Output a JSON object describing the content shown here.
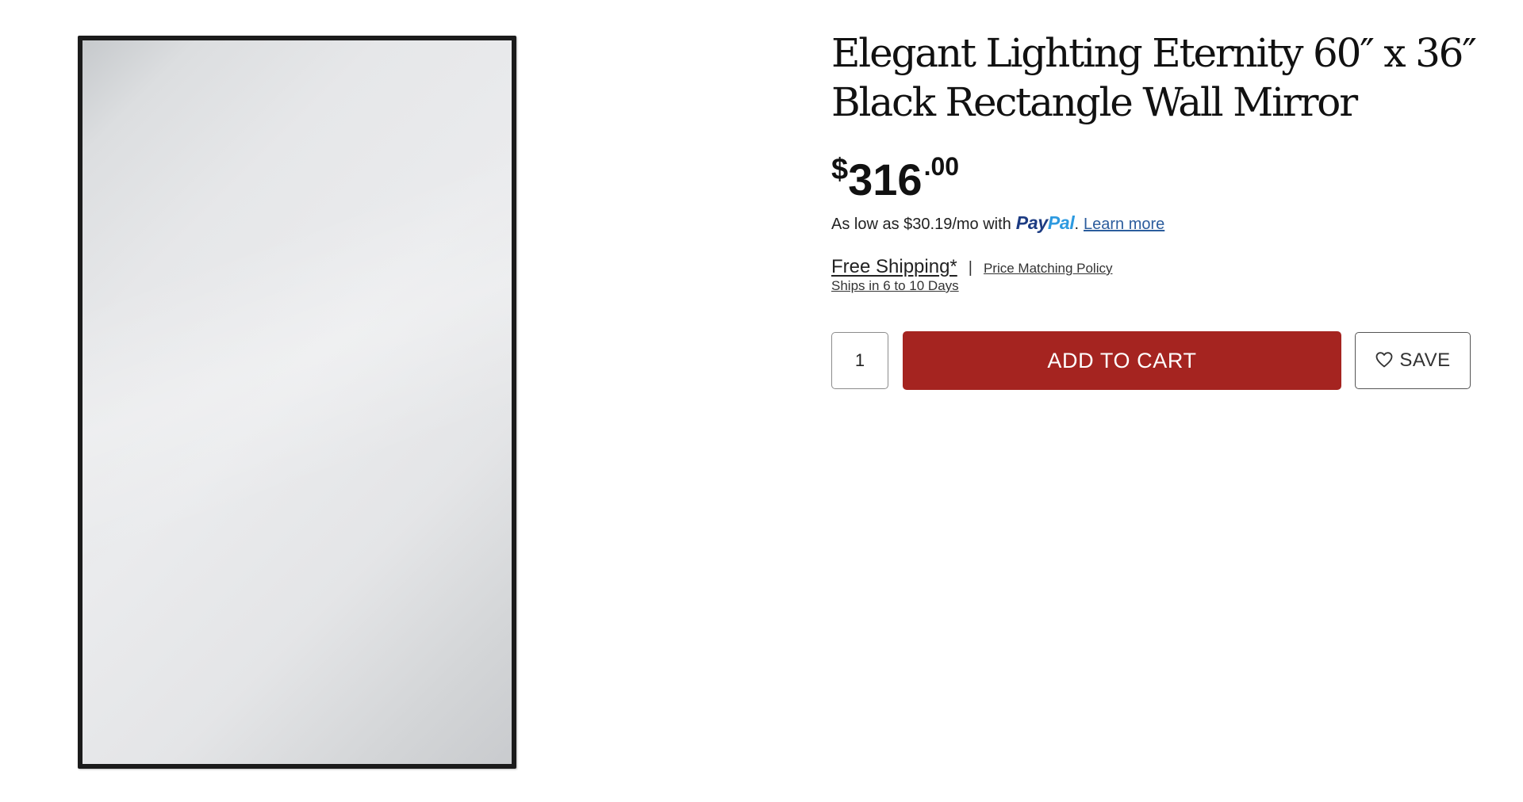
{
  "product": {
    "title_line1": "Elegant Lighting Eternity 60″ x 36″",
    "title_line2": "Black Rectangle Wall Mirror",
    "image": {
      "subject": "black rectangle wall mirror",
      "frame_color": "#1b1b1b"
    }
  },
  "price": {
    "currency": "$",
    "dollars": "316",
    "cents": ".00"
  },
  "financing": {
    "text": "As low as $30.19/mo with",
    "paypal_pay": "Pay",
    "paypal_pal": "Pal",
    "period": ".",
    "learn_more": "Learn more"
  },
  "shipping": {
    "free_shipping": "Free Shipping*",
    "separator": "|",
    "price_matching": "Price Matching Policy",
    "ships_in": "Ships in 6 to 10 Days"
  },
  "cart": {
    "quantity": "1",
    "add_to_cart_label": "ADD TO CART",
    "save_label": "SAVE",
    "save_icon": "heart-outline-icon"
  },
  "colors": {
    "add_to_cart_bg": "#a52420",
    "paypal_dark": "#1c3b82",
    "paypal_light": "#2d9ae0",
    "link": "#2c5d9d"
  }
}
